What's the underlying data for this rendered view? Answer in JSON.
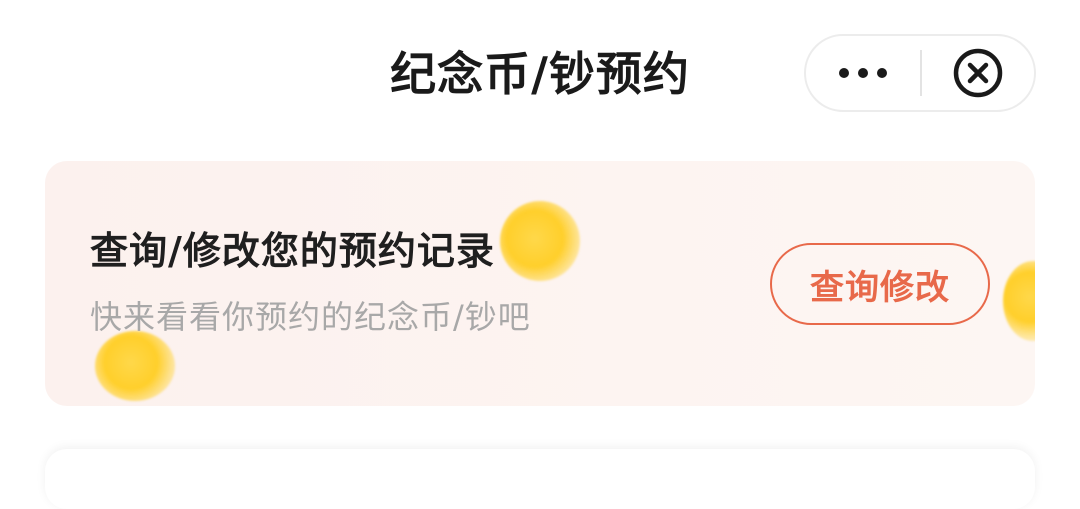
{
  "header": {
    "title": "纪念币/钞预约",
    "more_icon": "more-dots-icon",
    "close_icon": "close-circle-icon"
  },
  "record_card": {
    "title": "查询/修改您的预约记录",
    "subtitle": "快来看看你预约的纪念币/钞吧",
    "button_label": "查询修改"
  },
  "colors": {
    "accent": "#e8694a",
    "card_background": "#fcf1ee",
    "title_text": "#1a1a1a",
    "subtitle_text": "#a8a8a8",
    "coin": "#ffcf2b"
  }
}
